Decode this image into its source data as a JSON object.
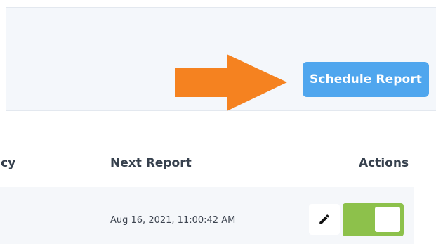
{
  "toolbar": {
    "schedule_button_label": "Schedule Report",
    "accent_color": "#4fa6ee",
    "arrow_color": "#f58220"
  },
  "table": {
    "columns": [
      "ncy",
      "Next Report",
      "Actions"
    ],
    "rows": [
      {
        "next_report": "Aug 16, 2021, 11:00:42 AM",
        "actions": {
          "edit_icon": "pencil-icon",
          "toggle_enabled": true,
          "toggle_color": "#8dc14b"
        }
      }
    ]
  }
}
